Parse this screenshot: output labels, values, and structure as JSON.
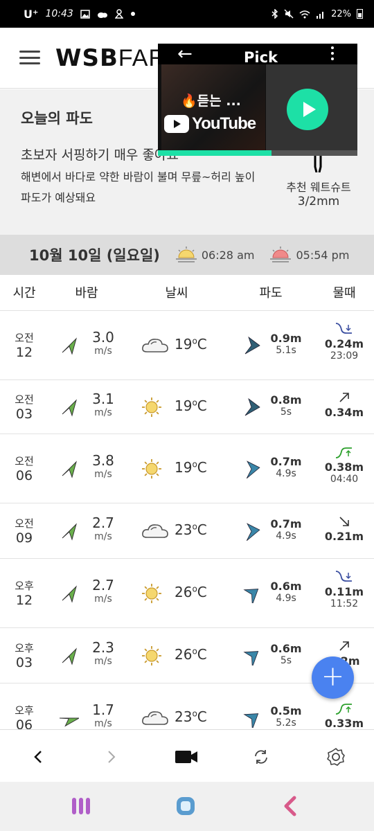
{
  "status_bar": {
    "carrier": "U⁺",
    "time": "10:43",
    "battery": "22%",
    "left_icons": [
      "gallery-icon",
      "cloud-icon",
      "tree-icon",
      "dot-icon"
    ],
    "right_icons": [
      "bluetooth-icon",
      "mute-icon",
      "wifi-icon",
      "signal-icon",
      "battery-icon"
    ]
  },
  "app": {
    "logo_bold": "WSB",
    "logo_light": "FARM"
  },
  "today": {
    "title": "오늘의 파도",
    "summary": "초보자 서핑하기 매우 좋아요",
    "description": "해변에서 바다로 약한 바람이 불며 무릎~허리 높이 파도가 예상돼요",
    "suit_label": "추천 웨트슈트",
    "suit_value": "3/2mm"
  },
  "date_bar": {
    "date": "10월 10일 (일요일)",
    "sunrise": "06:28 am",
    "sunset": "05:54 pm"
  },
  "columns": [
    "시간",
    "바람",
    "날씨",
    "파도",
    "물때"
  ],
  "rows": [
    {
      "ampm": "오전",
      "hour": "12",
      "wind": "3.0",
      "wind_unit": "m/s",
      "wind_dir": 225,
      "weather": "cloud",
      "temp": "19",
      "temp_unit": "C",
      "wave_h": "0.9m",
      "wave_p": "5.1s",
      "wave_dir": 200,
      "wave_color": "#2f5f75",
      "tide_icon": "low-tide",
      "tide_h": "0.24m",
      "tide_t": "23:09"
    },
    {
      "ampm": "오전",
      "hour": "03",
      "wind": "3.1",
      "wind_unit": "m/s",
      "wind_dir": 225,
      "weather": "sun",
      "temp": "19",
      "temp_unit": "C",
      "wave_h": "0.8m",
      "wave_p": "5s",
      "wave_dir": 200,
      "wave_color": "#2f5f75",
      "tide_icon": "rising",
      "tide_h": "0.34m",
      "tide_t": ""
    },
    {
      "ampm": "오전",
      "hour": "06",
      "wind": "3.8",
      "wind_unit": "m/s",
      "wind_dir": 225,
      "weather": "sun",
      "temp": "19",
      "temp_unit": "C",
      "wave_h": "0.7m",
      "wave_p": "4.9s",
      "wave_dir": 190,
      "wave_color": "#3a86a8",
      "tide_icon": "high-tide",
      "tide_h": "0.38m",
      "tide_t": "04:40"
    },
    {
      "ampm": "오전",
      "hour": "09",
      "wind": "2.7",
      "wind_unit": "m/s",
      "wind_dir": 225,
      "weather": "cloud",
      "temp": "23",
      "temp_unit": "C",
      "wave_h": "0.7m",
      "wave_p": "4.9s",
      "wave_dir": 190,
      "wave_color": "#3a86a8",
      "tide_icon": "falling",
      "tide_h": "0.21m",
      "tide_t": ""
    },
    {
      "ampm": "오후",
      "hour": "12",
      "wind": "2.7",
      "wind_unit": "m/s",
      "wind_dir": 225,
      "weather": "sun",
      "temp": "26",
      "temp_unit": "C",
      "wave_h": "0.6m",
      "wave_p": "4.9s",
      "wave_dir": 160,
      "wave_color": "#3a86a8",
      "tide_icon": "low-tide",
      "tide_h": "0.11m",
      "tide_t": "11:52"
    },
    {
      "ampm": "오후",
      "hour": "03",
      "wind": "2.3",
      "wind_unit": "m/s",
      "wind_dir": 225,
      "weather": "sun",
      "temp": "26",
      "temp_unit": "C",
      "wave_h": "0.6m",
      "wave_p": "5s",
      "wave_dir": 160,
      "wave_color": "#3a86a8",
      "tide_icon": "rising",
      "tide_h": "0.2m",
      "tide_t": ""
    },
    {
      "ampm": "오후",
      "hour": "06",
      "wind": "1.7",
      "wind_unit": "m/s",
      "wind_dir": 270,
      "weather": "cloud",
      "temp": "23",
      "temp_unit": "C",
      "wave_h": "0.5m",
      "wave_p": "5.2s",
      "wave_dir": 160,
      "wave_color": "#3a86a8",
      "tide_icon": "high-tide",
      "tide_h": "0.33m",
      "tide_t": ""
    }
  ],
  "fab_label": "+",
  "pip": {
    "title": "Pick",
    "caption": "🔥듣는 ...",
    "brand": "YouTube",
    "progress": 0.57
  },
  "colors": {
    "wind_arrow": "#6ab04c",
    "fab": "#4a82f0",
    "play": "#1de0a6",
    "sun_yellow": "#f5d76e",
    "tide_green": "#2ca02c",
    "tide_blue": "#3b4fa0"
  }
}
